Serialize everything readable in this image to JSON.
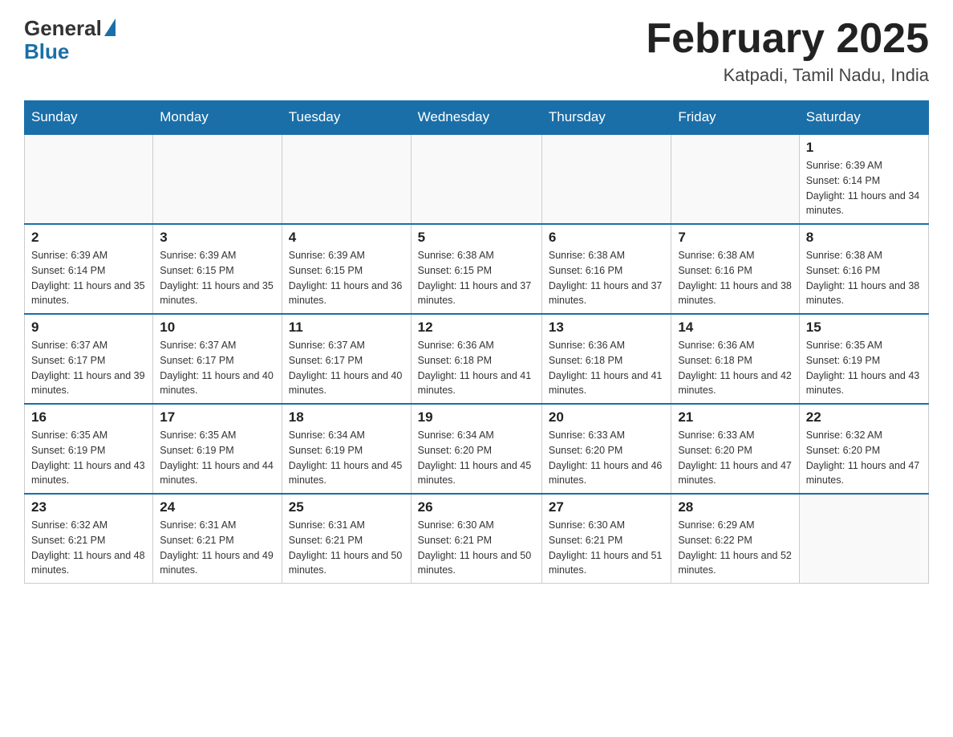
{
  "header": {
    "logo_general": "General",
    "logo_blue": "Blue",
    "month_title": "February 2025",
    "location": "Katpadi, Tamil Nadu, India"
  },
  "weekdays": [
    "Sunday",
    "Monday",
    "Tuesday",
    "Wednesday",
    "Thursday",
    "Friday",
    "Saturday"
  ],
  "weeks": [
    [
      {
        "day": "",
        "sunrise": "",
        "sunset": "",
        "daylight": ""
      },
      {
        "day": "",
        "sunrise": "",
        "sunset": "",
        "daylight": ""
      },
      {
        "day": "",
        "sunrise": "",
        "sunset": "",
        "daylight": ""
      },
      {
        "day": "",
        "sunrise": "",
        "sunset": "",
        "daylight": ""
      },
      {
        "day": "",
        "sunrise": "",
        "sunset": "",
        "daylight": ""
      },
      {
        "day": "",
        "sunrise": "",
        "sunset": "",
        "daylight": ""
      },
      {
        "day": "1",
        "sunrise": "Sunrise: 6:39 AM",
        "sunset": "Sunset: 6:14 PM",
        "daylight": "Daylight: 11 hours and 34 minutes."
      }
    ],
    [
      {
        "day": "2",
        "sunrise": "Sunrise: 6:39 AM",
        "sunset": "Sunset: 6:14 PM",
        "daylight": "Daylight: 11 hours and 35 minutes."
      },
      {
        "day": "3",
        "sunrise": "Sunrise: 6:39 AM",
        "sunset": "Sunset: 6:15 PM",
        "daylight": "Daylight: 11 hours and 35 minutes."
      },
      {
        "day": "4",
        "sunrise": "Sunrise: 6:39 AM",
        "sunset": "Sunset: 6:15 PM",
        "daylight": "Daylight: 11 hours and 36 minutes."
      },
      {
        "day": "5",
        "sunrise": "Sunrise: 6:38 AM",
        "sunset": "Sunset: 6:15 PM",
        "daylight": "Daylight: 11 hours and 37 minutes."
      },
      {
        "day": "6",
        "sunrise": "Sunrise: 6:38 AM",
        "sunset": "Sunset: 6:16 PM",
        "daylight": "Daylight: 11 hours and 37 minutes."
      },
      {
        "day": "7",
        "sunrise": "Sunrise: 6:38 AM",
        "sunset": "Sunset: 6:16 PM",
        "daylight": "Daylight: 11 hours and 38 minutes."
      },
      {
        "day": "8",
        "sunrise": "Sunrise: 6:38 AM",
        "sunset": "Sunset: 6:16 PM",
        "daylight": "Daylight: 11 hours and 38 minutes."
      }
    ],
    [
      {
        "day": "9",
        "sunrise": "Sunrise: 6:37 AM",
        "sunset": "Sunset: 6:17 PM",
        "daylight": "Daylight: 11 hours and 39 minutes."
      },
      {
        "day": "10",
        "sunrise": "Sunrise: 6:37 AM",
        "sunset": "Sunset: 6:17 PM",
        "daylight": "Daylight: 11 hours and 40 minutes."
      },
      {
        "day": "11",
        "sunrise": "Sunrise: 6:37 AM",
        "sunset": "Sunset: 6:17 PM",
        "daylight": "Daylight: 11 hours and 40 minutes."
      },
      {
        "day": "12",
        "sunrise": "Sunrise: 6:36 AM",
        "sunset": "Sunset: 6:18 PM",
        "daylight": "Daylight: 11 hours and 41 minutes."
      },
      {
        "day": "13",
        "sunrise": "Sunrise: 6:36 AM",
        "sunset": "Sunset: 6:18 PM",
        "daylight": "Daylight: 11 hours and 41 minutes."
      },
      {
        "day": "14",
        "sunrise": "Sunrise: 6:36 AM",
        "sunset": "Sunset: 6:18 PM",
        "daylight": "Daylight: 11 hours and 42 minutes."
      },
      {
        "day": "15",
        "sunrise": "Sunrise: 6:35 AM",
        "sunset": "Sunset: 6:19 PM",
        "daylight": "Daylight: 11 hours and 43 minutes."
      }
    ],
    [
      {
        "day": "16",
        "sunrise": "Sunrise: 6:35 AM",
        "sunset": "Sunset: 6:19 PM",
        "daylight": "Daylight: 11 hours and 43 minutes."
      },
      {
        "day": "17",
        "sunrise": "Sunrise: 6:35 AM",
        "sunset": "Sunset: 6:19 PM",
        "daylight": "Daylight: 11 hours and 44 minutes."
      },
      {
        "day": "18",
        "sunrise": "Sunrise: 6:34 AM",
        "sunset": "Sunset: 6:19 PM",
        "daylight": "Daylight: 11 hours and 45 minutes."
      },
      {
        "day": "19",
        "sunrise": "Sunrise: 6:34 AM",
        "sunset": "Sunset: 6:20 PM",
        "daylight": "Daylight: 11 hours and 45 minutes."
      },
      {
        "day": "20",
        "sunrise": "Sunrise: 6:33 AM",
        "sunset": "Sunset: 6:20 PM",
        "daylight": "Daylight: 11 hours and 46 minutes."
      },
      {
        "day": "21",
        "sunrise": "Sunrise: 6:33 AM",
        "sunset": "Sunset: 6:20 PM",
        "daylight": "Daylight: 11 hours and 47 minutes."
      },
      {
        "day": "22",
        "sunrise": "Sunrise: 6:32 AM",
        "sunset": "Sunset: 6:20 PM",
        "daylight": "Daylight: 11 hours and 47 minutes."
      }
    ],
    [
      {
        "day": "23",
        "sunrise": "Sunrise: 6:32 AM",
        "sunset": "Sunset: 6:21 PM",
        "daylight": "Daylight: 11 hours and 48 minutes."
      },
      {
        "day": "24",
        "sunrise": "Sunrise: 6:31 AM",
        "sunset": "Sunset: 6:21 PM",
        "daylight": "Daylight: 11 hours and 49 minutes."
      },
      {
        "day": "25",
        "sunrise": "Sunrise: 6:31 AM",
        "sunset": "Sunset: 6:21 PM",
        "daylight": "Daylight: 11 hours and 50 minutes."
      },
      {
        "day": "26",
        "sunrise": "Sunrise: 6:30 AM",
        "sunset": "Sunset: 6:21 PM",
        "daylight": "Daylight: 11 hours and 50 minutes."
      },
      {
        "day": "27",
        "sunrise": "Sunrise: 6:30 AM",
        "sunset": "Sunset: 6:21 PM",
        "daylight": "Daylight: 11 hours and 51 minutes."
      },
      {
        "day": "28",
        "sunrise": "Sunrise: 6:29 AM",
        "sunset": "Sunset: 6:22 PM",
        "daylight": "Daylight: 11 hours and 52 minutes."
      },
      {
        "day": "",
        "sunrise": "",
        "sunset": "",
        "daylight": ""
      }
    ]
  ]
}
